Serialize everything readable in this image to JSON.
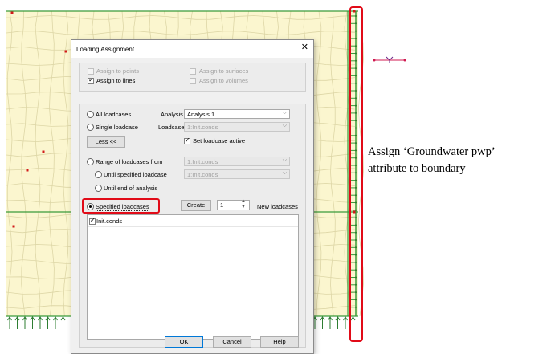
{
  "dialog": {
    "title": "Loading Assignment",
    "assign": {
      "points": "Assign to points",
      "lines": "Assign to lines",
      "surfaces": "Assign to surfaces",
      "volumes": "Assign to volumes"
    },
    "all_loadcases": "All loadcases",
    "analysis_label": "Analysis",
    "analysis_value": "Analysis 1",
    "single_loadcase": "Single loadcase",
    "loadcase_label": "Loadcase",
    "loadcase_value": "1:Init.conds",
    "less_button": "Less <<",
    "set_loadcase_active": "Set loadcase active",
    "range_from": "Range of loadcases from",
    "range_from_value": "1:Init.conds",
    "until_specified": "Until specified loadcase",
    "until_specified_value": "1:Init.conds",
    "until_end": "Until end of analysis",
    "specified_loadcases": "Specified loadcases",
    "create_button": "Create",
    "spin_value": "1",
    "new_loadcases": "New loadcases",
    "list_items": [
      "Init.conds"
    ],
    "ok_button": "OK",
    "cancel_button": "Cancel",
    "help_button": "Help"
  },
  "annotation": {
    "line1": "Assign ‘Groundwater pwp’",
    "line2": "attribute to boundary"
  },
  "colors": {
    "mesh_fill": "#fbf6cf",
    "mesh_line": "#ded7a8",
    "boundary_green": "#3a9b3a",
    "highlight_red": "#e10b18",
    "support_arrow": "#2e7d32"
  },
  "axis_icon": "y-axis-icon"
}
